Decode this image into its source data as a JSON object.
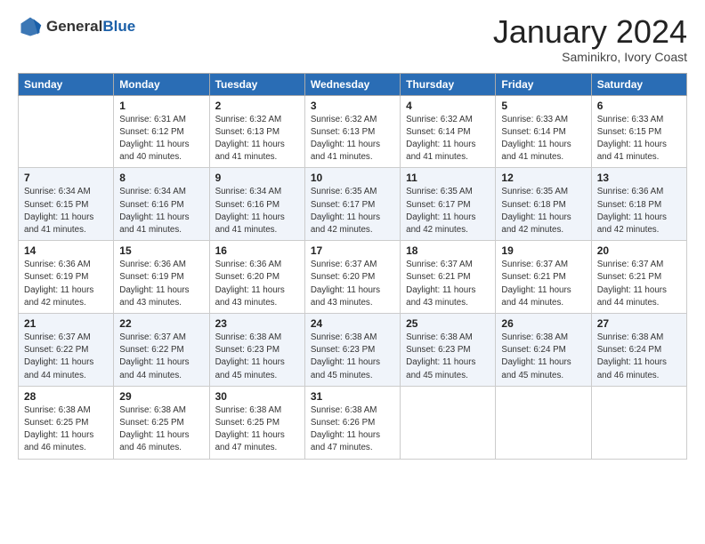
{
  "header": {
    "logo_general": "General",
    "logo_blue": "Blue",
    "month": "January 2024",
    "location": "Saminikro, Ivory Coast"
  },
  "days_of_week": [
    "Sunday",
    "Monday",
    "Tuesday",
    "Wednesday",
    "Thursday",
    "Friday",
    "Saturday"
  ],
  "weeks": [
    [
      {
        "num": "",
        "sunrise": "",
        "sunset": "",
        "daylight": ""
      },
      {
        "num": "1",
        "sunrise": "Sunrise: 6:31 AM",
        "sunset": "Sunset: 6:12 PM",
        "daylight": "Daylight: 11 hours and 40 minutes."
      },
      {
        "num": "2",
        "sunrise": "Sunrise: 6:32 AM",
        "sunset": "Sunset: 6:13 PM",
        "daylight": "Daylight: 11 hours and 41 minutes."
      },
      {
        "num": "3",
        "sunrise": "Sunrise: 6:32 AM",
        "sunset": "Sunset: 6:13 PM",
        "daylight": "Daylight: 11 hours and 41 minutes."
      },
      {
        "num": "4",
        "sunrise": "Sunrise: 6:32 AM",
        "sunset": "Sunset: 6:14 PM",
        "daylight": "Daylight: 11 hours and 41 minutes."
      },
      {
        "num": "5",
        "sunrise": "Sunrise: 6:33 AM",
        "sunset": "Sunset: 6:14 PM",
        "daylight": "Daylight: 11 hours and 41 minutes."
      },
      {
        "num": "6",
        "sunrise": "Sunrise: 6:33 AM",
        "sunset": "Sunset: 6:15 PM",
        "daylight": "Daylight: 11 hours and 41 minutes."
      }
    ],
    [
      {
        "num": "7",
        "sunrise": "Sunrise: 6:34 AM",
        "sunset": "Sunset: 6:15 PM",
        "daylight": "Daylight: 11 hours and 41 minutes."
      },
      {
        "num": "8",
        "sunrise": "Sunrise: 6:34 AM",
        "sunset": "Sunset: 6:16 PM",
        "daylight": "Daylight: 11 hours and 41 minutes."
      },
      {
        "num": "9",
        "sunrise": "Sunrise: 6:34 AM",
        "sunset": "Sunset: 6:16 PM",
        "daylight": "Daylight: 11 hours and 41 minutes."
      },
      {
        "num": "10",
        "sunrise": "Sunrise: 6:35 AM",
        "sunset": "Sunset: 6:17 PM",
        "daylight": "Daylight: 11 hours and 42 minutes."
      },
      {
        "num": "11",
        "sunrise": "Sunrise: 6:35 AM",
        "sunset": "Sunset: 6:17 PM",
        "daylight": "Daylight: 11 hours and 42 minutes."
      },
      {
        "num": "12",
        "sunrise": "Sunrise: 6:35 AM",
        "sunset": "Sunset: 6:18 PM",
        "daylight": "Daylight: 11 hours and 42 minutes."
      },
      {
        "num": "13",
        "sunrise": "Sunrise: 6:36 AM",
        "sunset": "Sunset: 6:18 PM",
        "daylight": "Daylight: 11 hours and 42 minutes."
      }
    ],
    [
      {
        "num": "14",
        "sunrise": "Sunrise: 6:36 AM",
        "sunset": "Sunset: 6:19 PM",
        "daylight": "Daylight: 11 hours and 42 minutes."
      },
      {
        "num": "15",
        "sunrise": "Sunrise: 6:36 AM",
        "sunset": "Sunset: 6:19 PM",
        "daylight": "Daylight: 11 hours and 43 minutes."
      },
      {
        "num": "16",
        "sunrise": "Sunrise: 6:36 AM",
        "sunset": "Sunset: 6:20 PM",
        "daylight": "Daylight: 11 hours and 43 minutes."
      },
      {
        "num": "17",
        "sunrise": "Sunrise: 6:37 AM",
        "sunset": "Sunset: 6:20 PM",
        "daylight": "Daylight: 11 hours and 43 minutes."
      },
      {
        "num": "18",
        "sunrise": "Sunrise: 6:37 AM",
        "sunset": "Sunset: 6:21 PM",
        "daylight": "Daylight: 11 hours and 43 minutes."
      },
      {
        "num": "19",
        "sunrise": "Sunrise: 6:37 AM",
        "sunset": "Sunset: 6:21 PM",
        "daylight": "Daylight: 11 hours and 44 minutes."
      },
      {
        "num": "20",
        "sunrise": "Sunrise: 6:37 AM",
        "sunset": "Sunset: 6:21 PM",
        "daylight": "Daylight: 11 hours and 44 minutes."
      }
    ],
    [
      {
        "num": "21",
        "sunrise": "Sunrise: 6:37 AM",
        "sunset": "Sunset: 6:22 PM",
        "daylight": "Daylight: 11 hours and 44 minutes."
      },
      {
        "num": "22",
        "sunrise": "Sunrise: 6:37 AM",
        "sunset": "Sunset: 6:22 PM",
        "daylight": "Daylight: 11 hours and 44 minutes."
      },
      {
        "num": "23",
        "sunrise": "Sunrise: 6:38 AM",
        "sunset": "Sunset: 6:23 PM",
        "daylight": "Daylight: 11 hours and 45 minutes."
      },
      {
        "num": "24",
        "sunrise": "Sunrise: 6:38 AM",
        "sunset": "Sunset: 6:23 PM",
        "daylight": "Daylight: 11 hours and 45 minutes."
      },
      {
        "num": "25",
        "sunrise": "Sunrise: 6:38 AM",
        "sunset": "Sunset: 6:23 PM",
        "daylight": "Daylight: 11 hours and 45 minutes."
      },
      {
        "num": "26",
        "sunrise": "Sunrise: 6:38 AM",
        "sunset": "Sunset: 6:24 PM",
        "daylight": "Daylight: 11 hours and 45 minutes."
      },
      {
        "num": "27",
        "sunrise": "Sunrise: 6:38 AM",
        "sunset": "Sunset: 6:24 PM",
        "daylight": "Daylight: 11 hours and 46 minutes."
      }
    ],
    [
      {
        "num": "28",
        "sunrise": "Sunrise: 6:38 AM",
        "sunset": "Sunset: 6:25 PM",
        "daylight": "Daylight: 11 hours and 46 minutes."
      },
      {
        "num": "29",
        "sunrise": "Sunrise: 6:38 AM",
        "sunset": "Sunset: 6:25 PM",
        "daylight": "Daylight: 11 hours and 46 minutes."
      },
      {
        "num": "30",
        "sunrise": "Sunrise: 6:38 AM",
        "sunset": "Sunset: 6:25 PM",
        "daylight": "Daylight: 11 hours and 47 minutes."
      },
      {
        "num": "31",
        "sunrise": "Sunrise: 6:38 AM",
        "sunset": "Sunset: 6:26 PM",
        "daylight": "Daylight: 11 hours and 47 minutes."
      },
      {
        "num": "",
        "sunrise": "",
        "sunset": "",
        "daylight": ""
      },
      {
        "num": "",
        "sunrise": "",
        "sunset": "",
        "daylight": ""
      },
      {
        "num": "",
        "sunrise": "",
        "sunset": "",
        "daylight": ""
      }
    ]
  ]
}
